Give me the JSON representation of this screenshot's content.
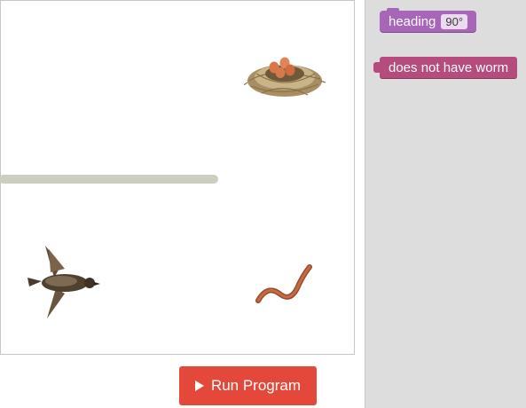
{
  "run_button": {
    "label": "Run Program"
  },
  "toolbox": {
    "heading_block": {
      "label": "heading",
      "value": "90°"
    },
    "condition_block": {
      "label": "does not have worm"
    }
  },
  "colors": {
    "run_button": "#e3483a",
    "heading_block": "#a766b7",
    "condition_block": "#b64b7d",
    "toolbox_bg": "#dddddd",
    "wall": "#cccfbf"
  },
  "sprites": [
    "nest-with-eggs",
    "bird",
    "worm"
  ]
}
